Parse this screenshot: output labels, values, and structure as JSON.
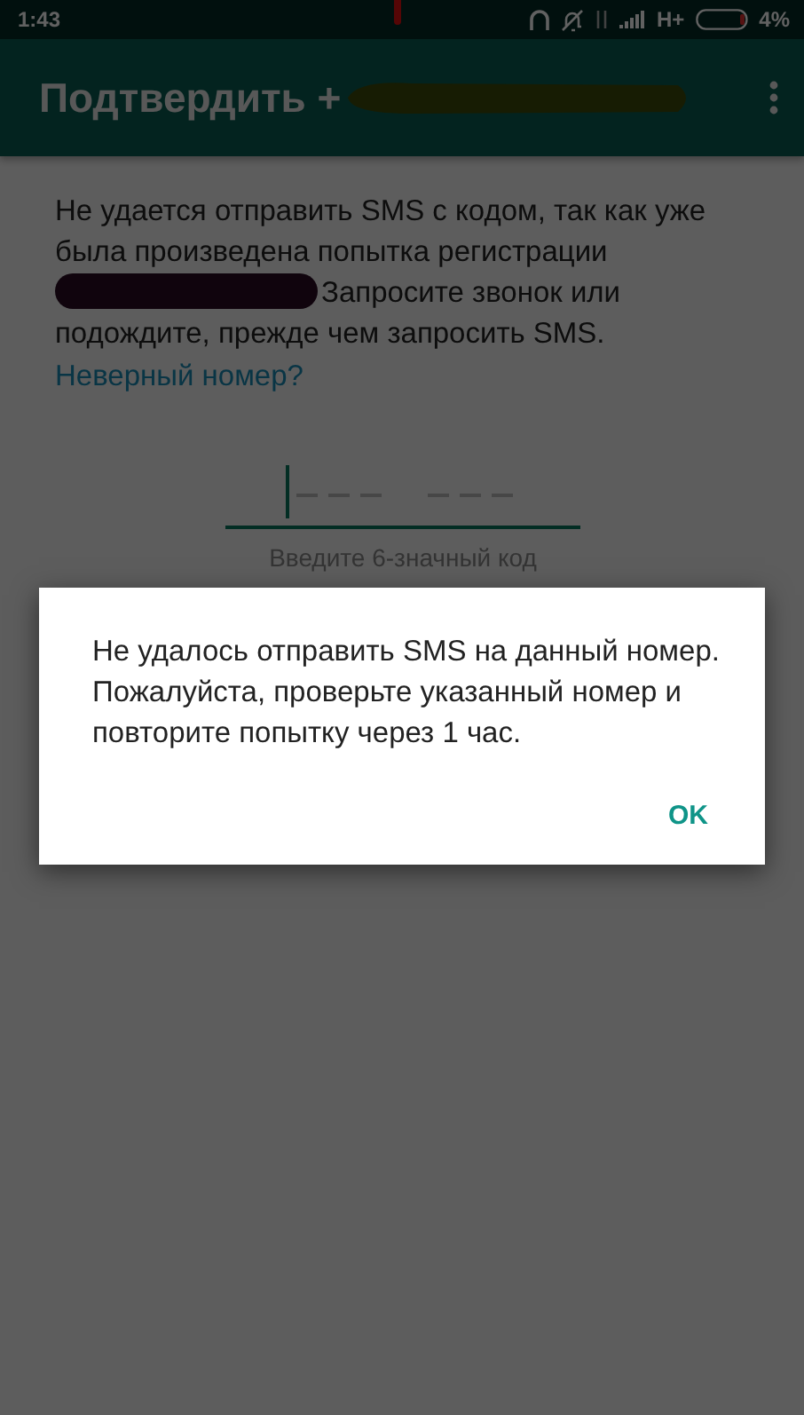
{
  "status_bar": {
    "time": "1:43",
    "network": "H+",
    "battery": "4%"
  },
  "app_bar": {
    "title": "Подтвердить +"
  },
  "message": {
    "before": "Не удается отправить SMS с кодом, так как уже была произведена попытка регистрации",
    "after": "Запросите звонок или подождите, прежде чем запросить SMS."
  },
  "link": "Неверный номер?",
  "code_field": {
    "hint": "Введите 6-значный код"
  },
  "dialog": {
    "text": "Не удалось отправить SMS на данный номер. Пожалуйста, проверьте указанный номер и повторите попытку через 1 час.",
    "buttons": [
      "OK"
    ]
  }
}
